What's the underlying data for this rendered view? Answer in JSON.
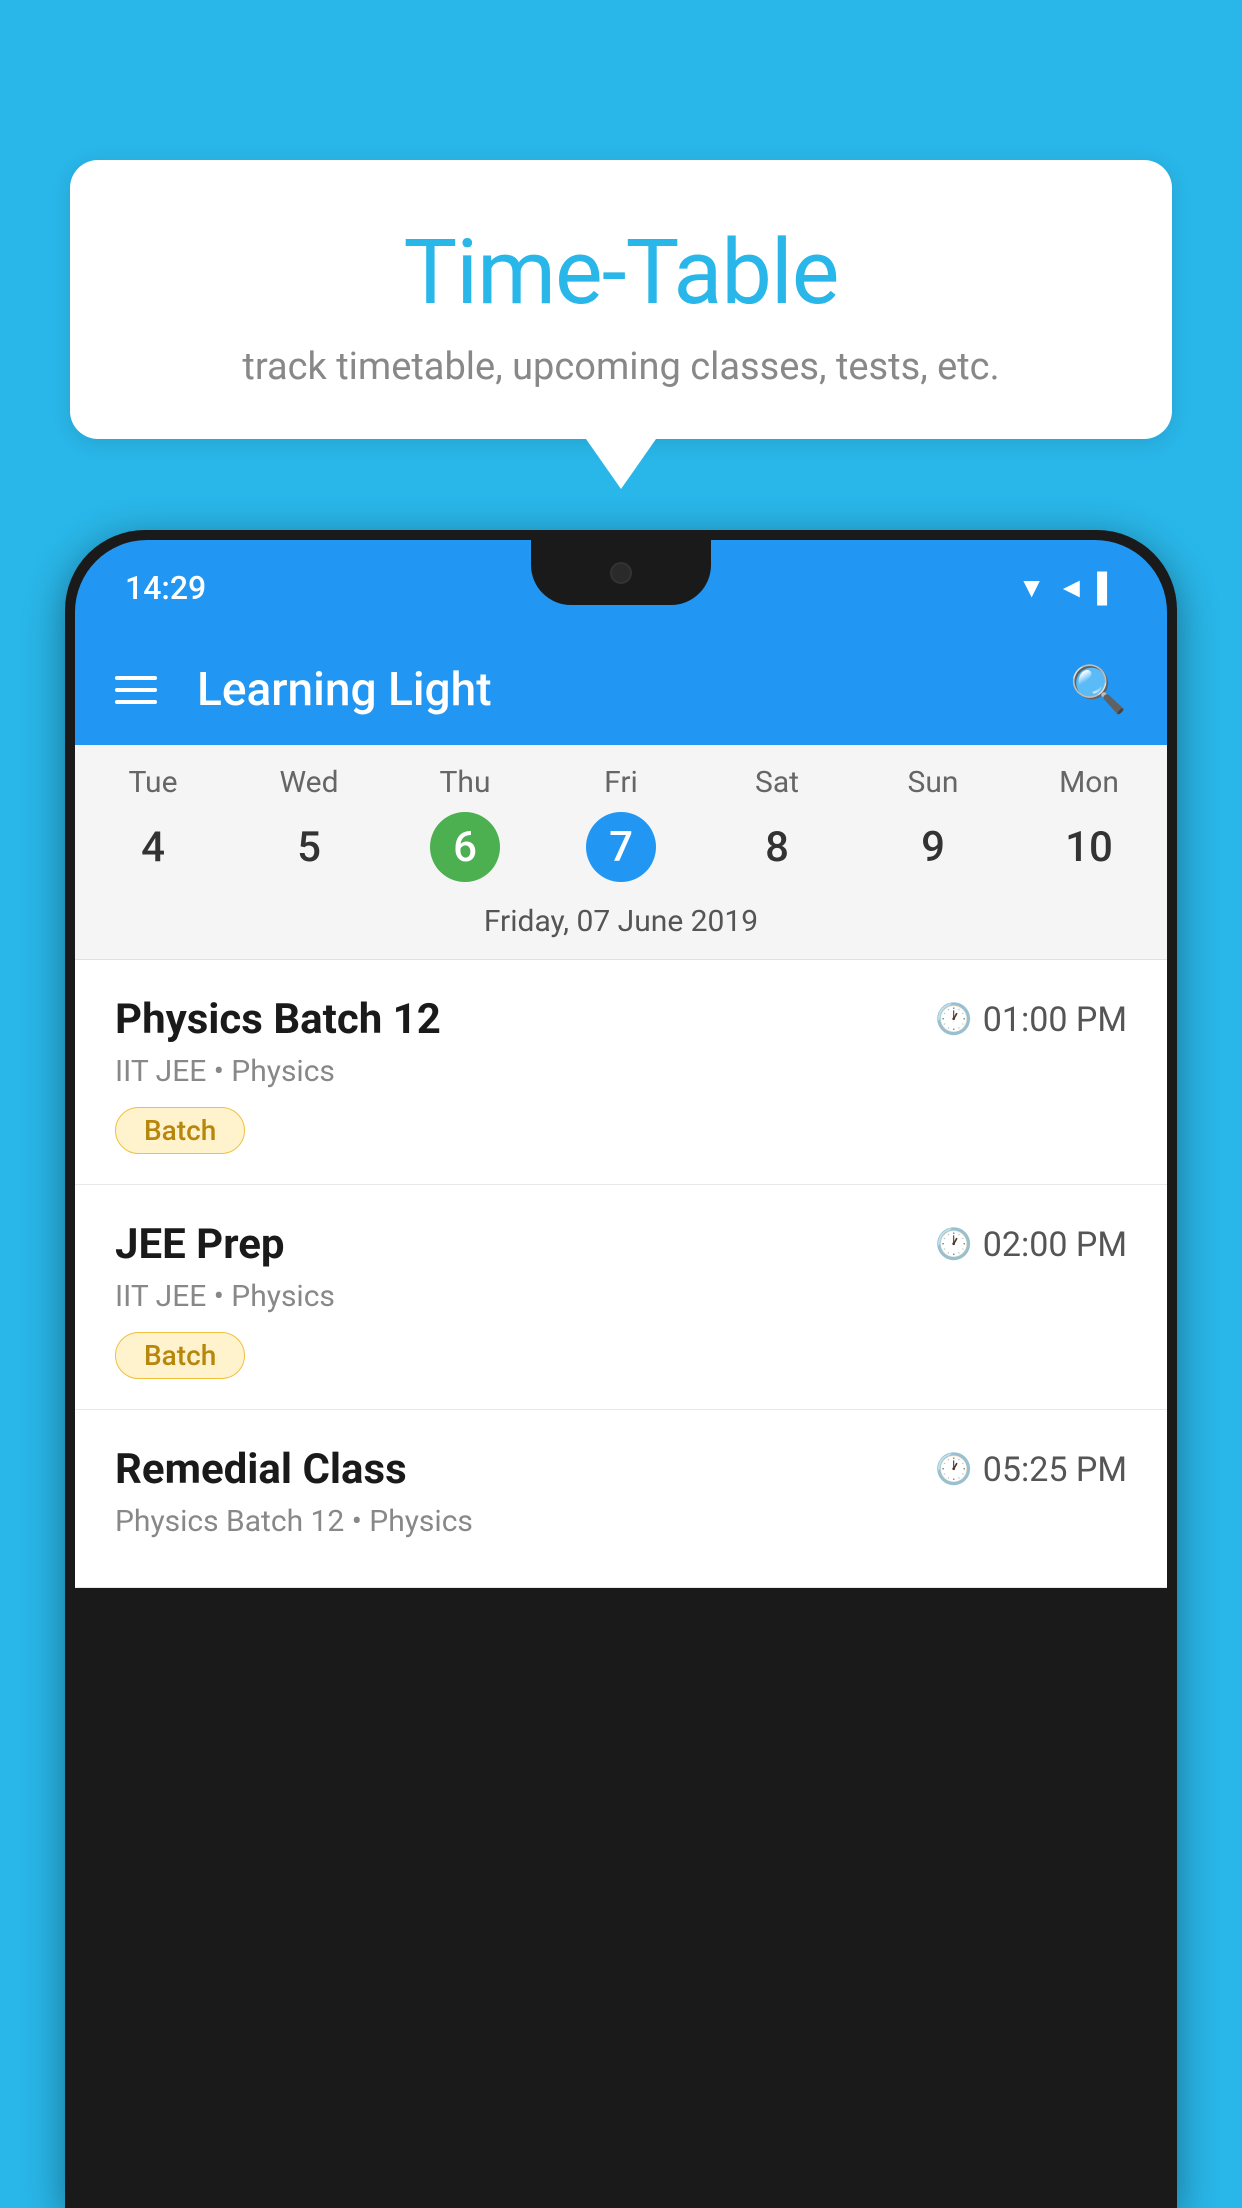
{
  "background_color": "#29b6e8",
  "speech_bubble": {
    "title": "Time-Table",
    "subtitle": "track timetable, upcoming classes, tests, etc."
  },
  "phone": {
    "status_bar": {
      "time": "14:29",
      "icons": [
        "▼",
        "◄",
        "▌"
      ]
    },
    "app_bar": {
      "title": "Learning Light",
      "menu_icon": "hamburger",
      "search_icon": "search"
    },
    "calendar": {
      "days": [
        {
          "name": "Tue",
          "number": "4",
          "state": "normal"
        },
        {
          "name": "Wed",
          "number": "5",
          "state": "normal"
        },
        {
          "name": "Thu",
          "number": "6",
          "state": "today"
        },
        {
          "name": "Fri",
          "number": "7",
          "state": "selected"
        },
        {
          "name": "Sat",
          "number": "8",
          "state": "normal"
        },
        {
          "name": "Sun",
          "number": "9",
          "state": "normal"
        },
        {
          "name": "Mon",
          "number": "10",
          "state": "normal"
        }
      ],
      "selected_date_label": "Friday, 07 June 2019"
    },
    "schedule": [
      {
        "title": "Physics Batch 12",
        "time": "01:00 PM",
        "subtitle": "IIT JEE • Physics",
        "badge": "Batch"
      },
      {
        "title": "JEE Prep",
        "time": "02:00 PM",
        "subtitle": "IIT JEE • Physics",
        "badge": "Batch"
      },
      {
        "title": "Remedial Class",
        "time": "05:25 PM",
        "subtitle": "Physics Batch 12 • Physics",
        "badge": null
      }
    ]
  }
}
